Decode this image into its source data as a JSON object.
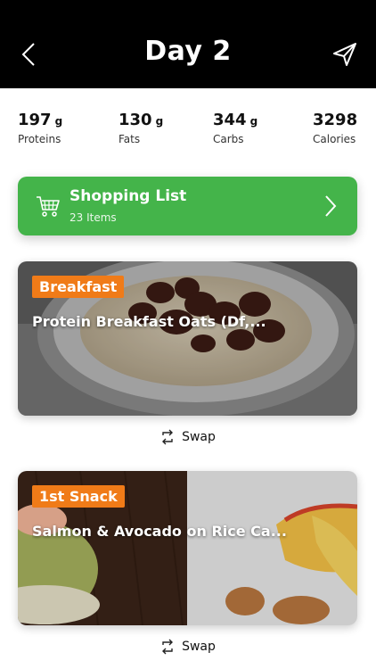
{
  "header": {
    "title": "Day 2",
    "back_icon": "chevron-left-icon",
    "share_icon": "paper-plane-icon"
  },
  "macros": [
    {
      "value": "197",
      "unit": "g",
      "label": "Proteins"
    },
    {
      "value": "130",
      "unit": "g",
      "label": "Fats"
    },
    {
      "value": "344",
      "unit": "g",
      "label": "Carbs"
    },
    {
      "value": "3298",
      "unit": "",
      "label": "Calories"
    }
  ],
  "shopping": {
    "title": "Shopping List",
    "count": "23 Items",
    "icon": "cart-icon",
    "color": "#44b44a"
  },
  "meals": [
    {
      "tag": "Breakfast",
      "title": "Protein Breakfast Oats (Df,...",
      "swap": "Swap"
    },
    {
      "tag": "1st Snack",
      "title": "Salmon & Avocado on Rice Ca...",
      "swap": "Swap"
    }
  ],
  "colors": {
    "accent": "#f07b18",
    "header_bg": "#000000"
  }
}
